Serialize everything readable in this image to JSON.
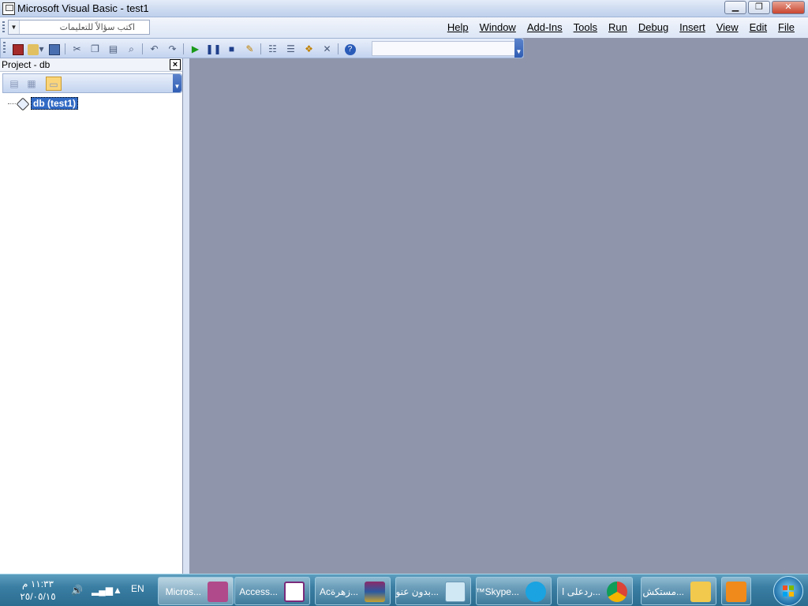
{
  "window": {
    "title": "Microsoft Visual Basic - test1",
    "buttons": {
      "minimize": "▁",
      "restore": "❐",
      "close": "✕"
    }
  },
  "menubar": {
    "ask_placeholder": "اكتب سؤالاً للتعليمات",
    "items": [
      "Help",
      "Window",
      "Add-Ins",
      "Tools",
      "Run",
      "Debug",
      "Insert",
      "View",
      "Edit",
      "File"
    ]
  },
  "toolbar": {
    "icons": [
      "view-access-icon",
      "insert-userform-icon",
      "save-icon",
      "separator",
      "cut-icon",
      "copy-icon",
      "paste-icon",
      "find-icon",
      "separator",
      "undo-icon",
      "redo-icon",
      "separator",
      "run-icon",
      "break-icon",
      "reset-icon",
      "design-mode-icon",
      "separator",
      "project-explorer-icon",
      "properties-window-icon",
      "object-browser-icon",
      "toolbox-icon",
      "separator",
      "help-icon"
    ]
  },
  "project": {
    "title": "Project - db",
    "close": "×",
    "tree": {
      "node_label": "db (test1)"
    }
  },
  "taskbar": {
    "clock_time": "١١:٣٣ م",
    "clock_date": "٢٥/٠٥/١٥",
    "language": "EN",
    "tasks": [
      {
        "label": "...Micros",
        "icon": "access-key-icon",
        "active": true
      },
      {
        "label": "...Access",
        "icon": "relationships-icon",
        "active": false
      },
      {
        "label": "...زهرةAc",
        "icon": "winrar-icon",
        "active": false
      },
      {
        "label": "...بدون عنو",
        "icon": "notepad-icon",
        "active": false
      },
      {
        "label": "...Skype™",
        "icon": "skype-icon",
        "active": false
      },
      {
        "label": "...ردعلى ا",
        "icon": "chrome-icon",
        "active": false
      },
      {
        "label": "...مستكش",
        "icon": "explorer-folder-icon",
        "active": false
      }
    ],
    "colors": {
      "accent": "#3b7ea3",
      "selection": "#316ac5"
    }
  }
}
